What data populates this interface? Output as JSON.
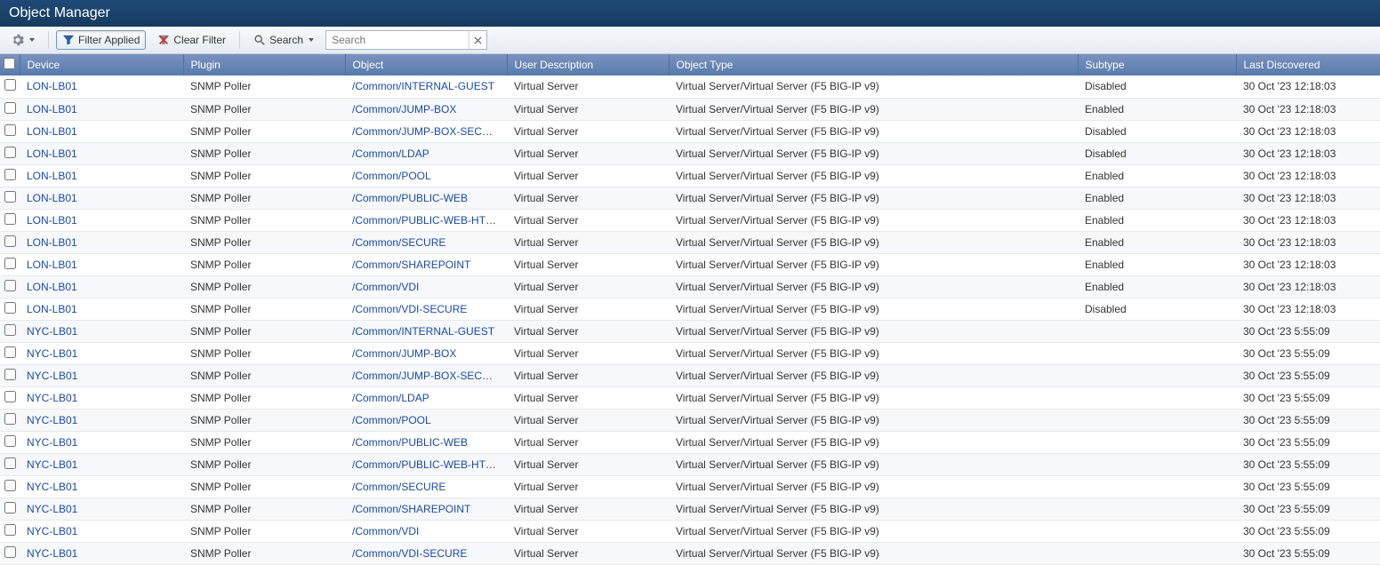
{
  "title": "Object Manager",
  "toolbar": {
    "filter_applied_label": "Filter Applied",
    "clear_filter_label": "Clear Filter",
    "search_label": "Search",
    "search_placeholder": "Search",
    "search_value": ""
  },
  "columns": {
    "device": "Device",
    "plugin": "Plugin",
    "object": "Object",
    "user_description": "User Description",
    "object_type": "Object Type",
    "subtype": "Subtype",
    "last_discovered": "Last Discovered"
  },
  "rows": [
    {
      "device": "LON-LB01",
      "plugin": "SNMP Poller",
      "object": "/Common/INTERNAL-GUEST",
      "user_description": "Virtual Server",
      "object_type": "Virtual Server/Virtual Server (F5 BIG-IP v9)",
      "subtype": "Disabled",
      "last_discovered": "30 Oct '23 12:18:03"
    },
    {
      "device": "LON-LB01",
      "plugin": "SNMP Poller",
      "object": "/Common/JUMP-BOX",
      "user_description": "Virtual Server",
      "object_type": "Virtual Server/Virtual Server (F5 BIG-IP v9)",
      "subtype": "Enabled",
      "last_discovered": "30 Oct '23 12:18:03"
    },
    {
      "device": "LON-LB01",
      "plugin": "SNMP Poller",
      "object": "/Common/JUMP-BOX-SECURE",
      "user_description": "Virtual Server",
      "object_type": "Virtual Server/Virtual Server (F5 BIG-IP v9)",
      "subtype": "Disabled",
      "last_discovered": "30 Oct '23 12:18:03"
    },
    {
      "device": "LON-LB01",
      "plugin": "SNMP Poller",
      "object": "/Common/LDAP",
      "user_description": "Virtual Server",
      "object_type": "Virtual Server/Virtual Server (F5 BIG-IP v9)",
      "subtype": "Disabled",
      "last_discovered": "30 Oct '23 12:18:03"
    },
    {
      "device": "LON-LB01",
      "plugin": "SNMP Poller",
      "object": "/Common/POOL",
      "user_description": "Virtual Server",
      "object_type": "Virtual Server/Virtual Server (F5 BIG-IP v9)",
      "subtype": "Enabled",
      "last_discovered": "30 Oct '23 12:18:03"
    },
    {
      "device": "LON-LB01",
      "plugin": "SNMP Poller",
      "object": "/Common/PUBLIC-WEB",
      "user_description": "Virtual Server",
      "object_type": "Virtual Server/Virtual Server (F5 BIG-IP v9)",
      "subtype": "Enabled",
      "last_discovered": "30 Oct '23 12:18:03"
    },
    {
      "device": "LON-LB01",
      "plugin": "SNMP Poller",
      "object": "/Common/PUBLIC-WEB-HTTPS",
      "user_description": "Virtual Server",
      "object_type": "Virtual Server/Virtual Server (F5 BIG-IP v9)",
      "subtype": "Enabled",
      "last_discovered": "30 Oct '23 12:18:03"
    },
    {
      "device": "LON-LB01",
      "plugin": "SNMP Poller",
      "object": "/Common/SECURE",
      "user_description": "Virtual Server",
      "object_type": "Virtual Server/Virtual Server (F5 BIG-IP v9)",
      "subtype": "Enabled",
      "last_discovered": "30 Oct '23 12:18:03"
    },
    {
      "device": "LON-LB01",
      "plugin": "SNMP Poller",
      "object": "/Common/SHAREPOINT",
      "user_description": "Virtual Server",
      "object_type": "Virtual Server/Virtual Server (F5 BIG-IP v9)",
      "subtype": "Enabled",
      "last_discovered": "30 Oct '23 12:18:03"
    },
    {
      "device": "LON-LB01",
      "plugin": "SNMP Poller",
      "object": "/Common/VDI",
      "user_description": "Virtual Server",
      "object_type": "Virtual Server/Virtual Server (F5 BIG-IP v9)",
      "subtype": "Enabled",
      "last_discovered": "30 Oct '23 12:18:03"
    },
    {
      "device": "LON-LB01",
      "plugin": "SNMP Poller",
      "object": "/Common/VDI-SECURE",
      "user_description": "Virtual Server",
      "object_type": "Virtual Server/Virtual Server (F5 BIG-IP v9)",
      "subtype": "Disabled",
      "last_discovered": "30 Oct '23 12:18:03"
    },
    {
      "device": "NYC-LB01",
      "plugin": "SNMP Poller",
      "object": "/Common/INTERNAL-GUEST",
      "user_description": "Virtual Server",
      "object_type": "Virtual Server/Virtual Server (F5 BIG-IP v9)",
      "subtype": "",
      "last_discovered": "30 Oct '23 5:55:09"
    },
    {
      "device": "NYC-LB01",
      "plugin": "SNMP Poller",
      "object": "/Common/JUMP-BOX",
      "user_description": "Virtual Server",
      "object_type": "Virtual Server/Virtual Server (F5 BIG-IP v9)",
      "subtype": "",
      "last_discovered": "30 Oct '23 5:55:09"
    },
    {
      "device": "NYC-LB01",
      "plugin": "SNMP Poller",
      "object": "/Common/JUMP-BOX-SECURE",
      "user_description": "Virtual Server",
      "object_type": "Virtual Server/Virtual Server (F5 BIG-IP v9)",
      "subtype": "",
      "last_discovered": "30 Oct '23 5:55:09"
    },
    {
      "device": "NYC-LB01",
      "plugin": "SNMP Poller",
      "object": "/Common/LDAP",
      "user_description": "Virtual Server",
      "object_type": "Virtual Server/Virtual Server (F5 BIG-IP v9)",
      "subtype": "",
      "last_discovered": "30 Oct '23 5:55:09"
    },
    {
      "device": "NYC-LB01",
      "plugin": "SNMP Poller",
      "object": "/Common/POOL",
      "user_description": "Virtual Server",
      "object_type": "Virtual Server/Virtual Server (F5 BIG-IP v9)",
      "subtype": "",
      "last_discovered": "30 Oct '23 5:55:09"
    },
    {
      "device": "NYC-LB01",
      "plugin": "SNMP Poller",
      "object": "/Common/PUBLIC-WEB",
      "user_description": "Virtual Server",
      "object_type": "Virtual Server/Virtual Server (F5 BIG-IP v9)",
      "subtype": "",
      "last_discovered": "30 Oct '23 5:55:09"
    },
    {
      "device": "NYC-LB01",
      "plugin": "SNMP Poller",
      "object": "/Common/PUBLIC-WEB-HTTPS",
      "user_description": "Virtual Server",
      "object_type": "Virtual Server/Virtual Server (F5 BIG-IP v9)",
      "subtype": "",
      "last_discovered": "30 Oct '23 5:55:09"
    },
    {
      "device": "NYC-LB01",
      "plugin": "SNMP Poller",
      "object": "/Common/SECURE",
      "user_description": "Virtual Server",
      "object_type": "Virtual Server/Virtual Server (F5 BIG-IP v9)",
      "subtype": "",
      "last_discovered": "30 Oct '23 5:55:09"
    },
    {
      "device": "NYC-LB01",
      "plugin": "SNMP Poller",
      "object": "/Common/SHAREPOINT",
      "user_description": "Virtual Server",
      "object_type": "Virtual Server/Virtual Server (F5 BIG-IP v9)",
      "subtype": "",
      "last_discovered": "30 Oct '23 5:55:09"
    },
    {
      "device": "NYC-LB01",
      "plugin": "SNMP Poller",
      "object": "/Common/VDI",
      "user_description": "Virtual Server",
      "object_type": "Virtual Server/Virtual Server (F5 BIG-IP v9)",
      "subtype": "",
      "last_discovered": "30 Oct '23 5:55:09"
    },
    {
      "device": "NYC-LB01",
      "plugin": "SNMP Poller",
      "object": "/Common/VDI-SECURE",
      "user_description": "Virtual Server",
      "object_type": "Virtual Server/Virtual Server (F5 BIG-IP v9)",
      "subtype": "",
      "last_discovered": "30 Oct '23 5:55:09"
    }
  ]
}
